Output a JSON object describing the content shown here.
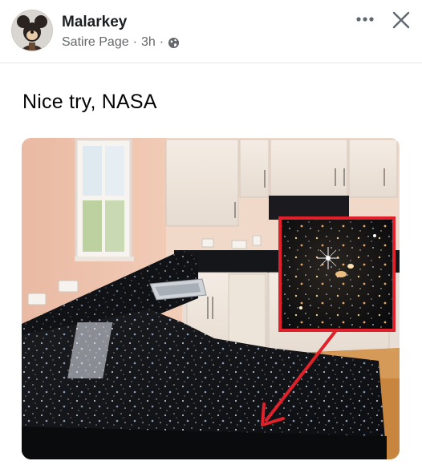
{
  "post": {
    "author": "Malarkey",
    "page_type": "Satire Page",
    "separator": "·",
    "time": "3h",
    "audience_icon": "globe-icon",
    "text": "Nice try, NASA",
    "image": {
      "subject": "granite-countertop-meme",
      "highlight_color": "#e0202a"
    }
  },
  "header_actions": {
    "more_icon": "more-dots-icon",
    "close_icon": "close-icon"
  },
  "colors": {
    "name": "#1c1e21",
    "meta": "#65676b",
    "text": "#050505"
  }
}
